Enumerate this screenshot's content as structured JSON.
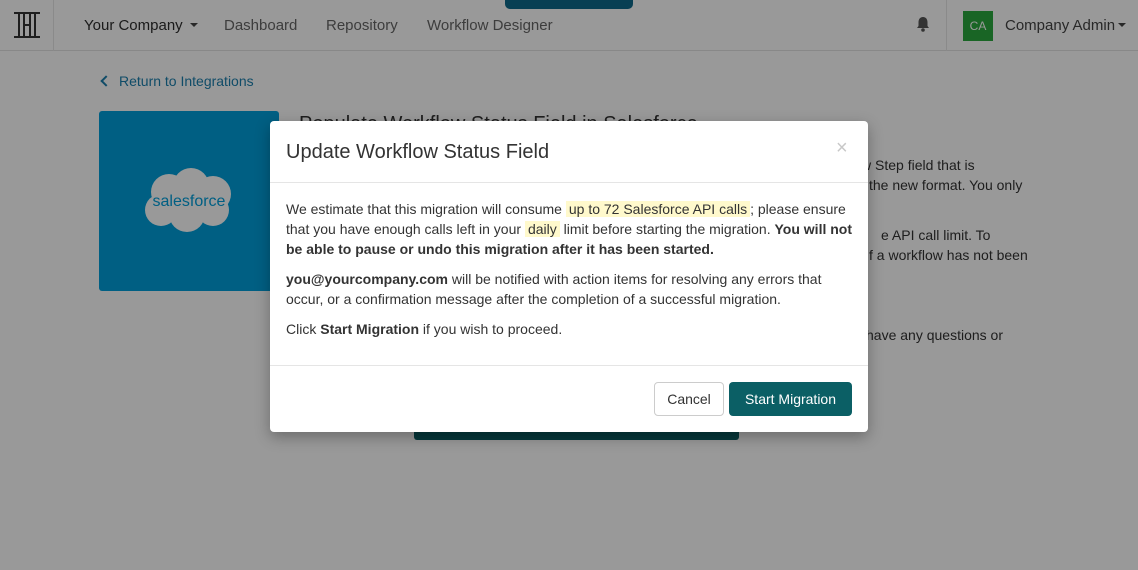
{
  "nav": {
    "company": "Your Company",
    "links": [
      "Dashboard",
      "Repository",
      "Workflow Designer"
    ],
    "avatar_initials": "CA",
    "user": "Company Admin"
  },
  "page": {
    "back_link": "Return to Integrations",
    "title_line": "Populate Workflow Status Field in Salesforce",
    "fragments": [
      "w Step field that is",
      "the new format. You only",
      "e API call limit. To",
      "f a workflow has not been",
      "have any questions or"
    ],
    "tile_logo_text": "salesforce"
  },
  "modal": {
    "title": "Update Workflow Status Field",
    "close_symbol": "×",
    "p1_prefix": "We estimate that this migration will consume",
    "p1_highlight": "up to 72 Salesforce API calls",
    "p1_middle": "; please ensure that you have enough calls left in your",
    "p1_daily": "daily",
    "p1_suffix": "limit before starting the migration.",
    "p1_bold": "You will not be able to pause or undo this migration after it has been started.",
    "p2_email": "you@yourcompany.com",
    "p2_rest": "will be notified with action items for resolving any errors that occur, or a confirmation message after the completion of a successful migration.",
    "p3_prefix": "Click",
    "p3_bold": "Start Migration",
    "p3_suffix": "if you wish to proceed.",
    "cancel_label": "Cancel",
    "start_label": "Start Migration"
  },
  "colors": {
    "accent": "#0b5f65",
    "salesforce_blue": "#009edb",
    "avatar_green": "#2aa83e",
    "link_blue": "#1b7fad"
  }
}
